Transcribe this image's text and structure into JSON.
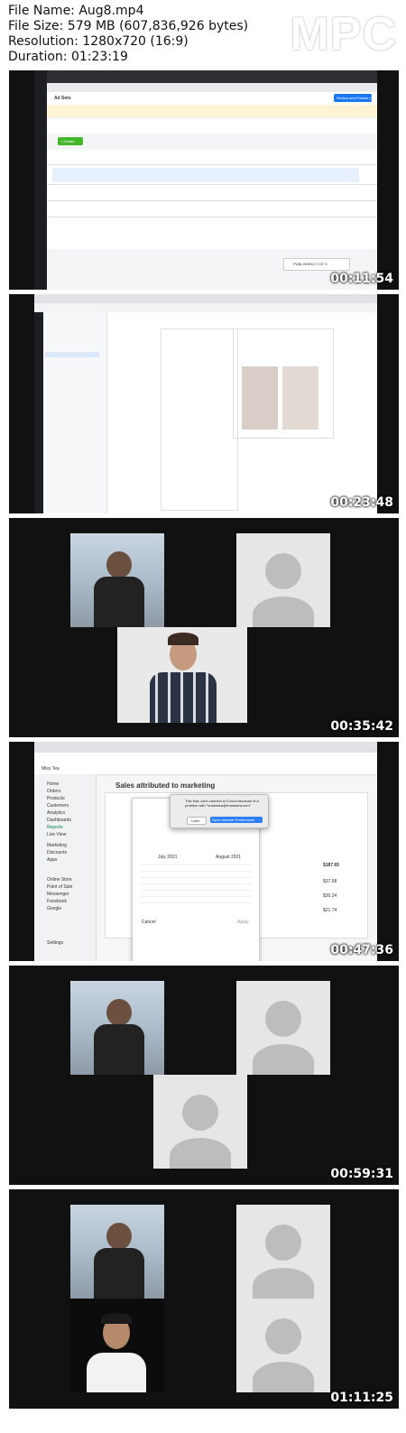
{
  "header": {
    "file_name": "File Name: Aug8.mp4",
    "file_size": "File Size: 579 MB (607,836,926 bytes)",
    "resolution": "Resolution: 1280x720 (16:9)",
    "duration": "Duration: 01:23:19",
    "logo": "MPC"
  },
  "thumbnails": [
    {
      "timestamp": "00:11:54",
      "kind": "ads-manager"
    },
    {
      "timestamp": "00:23:48",
      "kind": "ad-editor"
    },
    {
      "timestamp": "00:35:42",
      "kind": "video-call"
    },
    {
      "timestamp": "00:47:36",
      "kind": "shopify"
    },
    {
      "timestamp": "00:59:31",
      "kind": "video-call"
    },
    {
      "timestamp": "01:11:25",
      "kind": "video-call"
    }
  ],
  "frame1": {
    "campaign_tab": "Ad Sets",
    "buttons": {
      "create": "+ Create",
      "review": "Review and Publish (1)"
    },
    "publishing": "PUBLISHING 0 OF 5"
  },
  "frame4": {
    "page_title": "Sales attributed to marketing",
    "dialog_text": "This Mac can't connect to iCloud because of a problem with \"bradastra@bradastra.com\"",
    "later": "Later",
    "prefs": "Open Internet Preferences",
    "month_left": "July 2021",
    "month_right": "August 2021",
    "cancel": "Cancel",
    "apply": "Apply",
    "store": "Miss Tea",
    "nav": [
      "Home",
      "Orders",
      "Products",
      "Customers",
      "Analytics",
      "Dashboards",
      "Reports",
      "Live View",
      "Marketing",
      "Discounts",
      "Apps",
      "Online Store",
      "Point of Sale",
      "Messenger",
      "Facebook",
      "Google",
      "Settings"
    ],
    "values": [
      "$187.65",
      "$37.68",
      "$30.24",
      "$21.74"
    ]
  }
}
